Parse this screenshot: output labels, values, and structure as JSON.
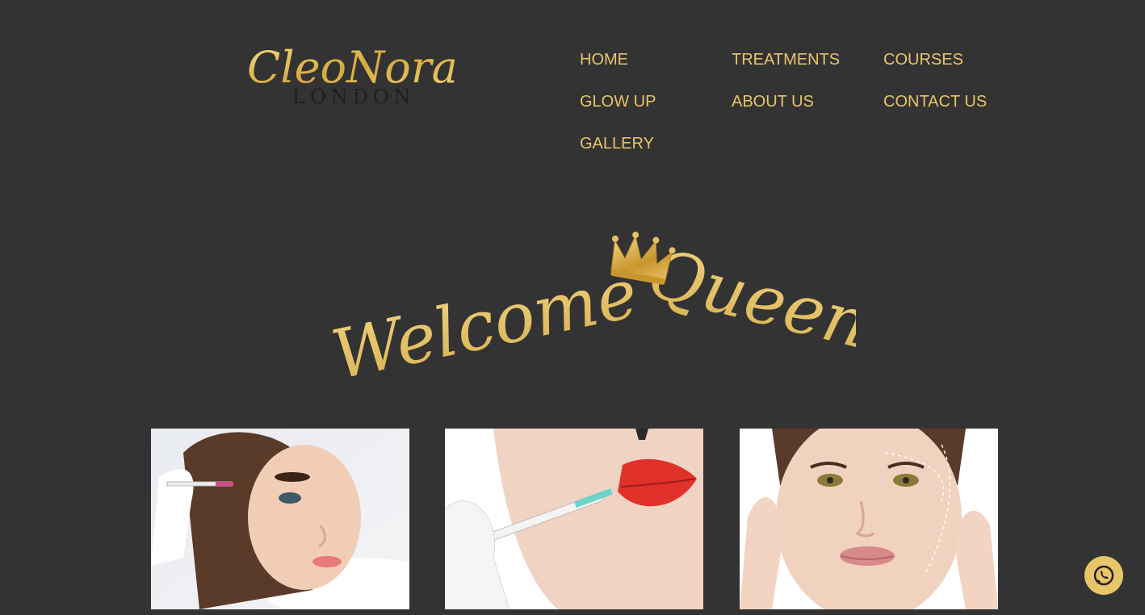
{
  "brand": {
    "logo_script": "CleoNora",
    "logo_sub": "LONDON"
  },
  "nav": {
    "items": [
      {
        "label": "HOME"
      },
      {
        "label": "TREATMENTS"
      },
      {
        "label": "COURSES"
      },
      {
        "label": "GLOW UP"
      },
      {
        "label": "ABOUT US"
      },
      {
        "label": "CONTACT US"
      },
      {
        "label": "GALLERY"
      }
    ]
  },
  "hero": {
    "word1": "Welcome",
    "word2": "Queen",
    "icon": "crown-icon"
  },
  "gallery": {
    "photos": [
      {
        "subject": "forehead-injection-photo"
      },
      {
        "subject": "lip-filler-photo"
      },
      {
        "subject": "face-contour-photo"
      }
    ]
  },
  "chat": {
    "icon": "whatsapp-icon"
  },
  "colors": {
    "background": "#333333",
    "accent_gold": "#E8C46A",
    "logo_dark": "#1E1E1E"
  }
}
